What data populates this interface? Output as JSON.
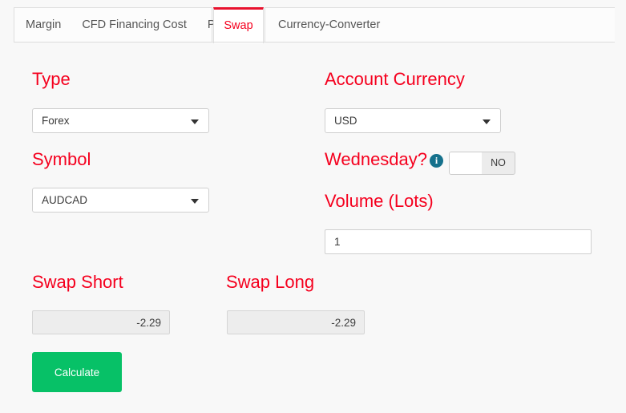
{
  "tabs": {
    "group_left": [
      {
        "label": "Margin",
        "name": "tab-margin",
        "active": false
      },
      {
        "label": "CFD Financing Cost",
        "name": "tab-cfd-financing-cost",
        "active": false
      },
      {
        "label": "Pip",
        "name": "tab-pip",
        "active": false
      }
    ],
    "active_tab": {
      "label": "Swap",
      "name": "tab-swap",
      "active": true
    },
    "group_right": [
      {
        "label": "Currency-Converter",
        "name": "tab-currency-converter",
        "active": false
      }
    ]
  },
  "form": {
    "type": {
      "label": "Type",
      "value": "Forex",
      "icon": "chevron-down-icon"
    },
    "symbol": {
      "label": "Symbol",
      "value": "AUDCAD",
      "icon": "chevron-down-icon"
    },
    "account_currency": {
      "label": "Account Currency",
      "value": "USD",
      "icon": "chevron-down-icon"
    },
    "wednesday": {
      "label": "Wednesday?",
      "info_icon": "info-icon",
      "toggle_value": "NO"
    },
    "volume": {
      "label": "Volume (Lots)",
      "value": "1",
      "placeholder": "1"
    }
  },
  "results": {
    "swap_short": {
      "label": "Swap Short",
      "value": "-2.29"
    },
    "swap_long": {
      "label": "Swap Long",
      "value": "-2.29"
    }
  },
  "actions": {
    "calculate_label": "Calculate"
  },
  "colors": {
    "label_red": "#f5001e",
    "tab_active_border": "#e8112d",
    "button_green": "#07c167",
    "info_icon_blue": "#15718c",
    "page_background": "#f8f8f8"
  }
}
